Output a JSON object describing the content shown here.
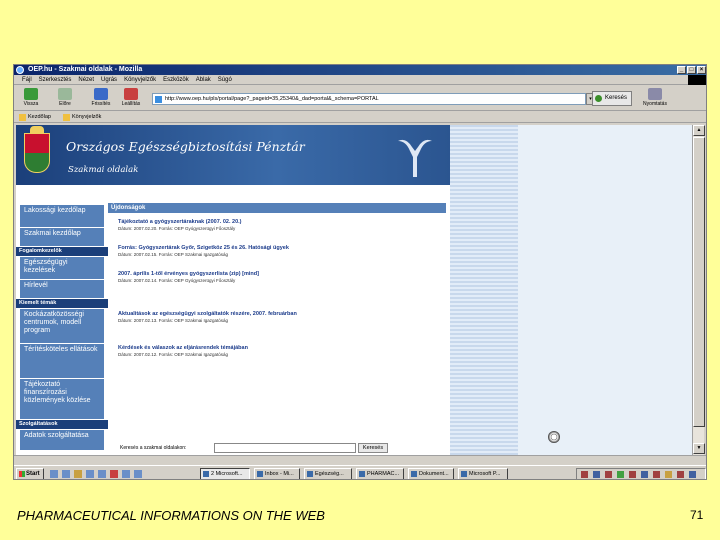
{
  "browser": {
    "title": "OEP.hu - Szakmai oldalak - Mozilla",
    "window_buttons": [
      "_",
      "□",
      "×"
    ],
    "menu": [
      "Fájl",
      "Szerkesztés",
      "Nézet",
      "Ugrás",
      "Könyvjelzők",
      "Eszközök",
      "Ablak",
      "Súgó"
    ],
    "brand": "",
    "toolbar": [
      "Vissza",
      "Előre",
      "Frissítés",
      "Leállítás"
    ],
    "address": "http://www.oep.hu/pls/portal/page?_pageid=35,25340&_dad=portal&_schema=PORTAL",
    "go_label": "Keresés",
    "print_label": "Nyomtatás",
    "links": [
      "Kezdőlap",
      "Könyvjelzők"
    ]
  },
  "site": {
    "org_name": "Országos Egészségbiztosítási Pénztár",
    "subtitle": "Szakmai oldalak",
    "left_nav": [
      {
        "type": "btn",
        "label": "Lakossági kezdőlap"
      },
      {
        "type": "btn",
        "label": "Szakmai kezdőlap"
      },
      {
        "type": "sec",
        "label": "Fogalomkezelők"
      },
      {
        "type": "btn",
        "label": "Egészségügyi kezelések"
      },
      {
        "type": "btn",
        "label": "Hírlevél"
      },
      {
        "type": "sec",
        "label": "Kiemelt témák"
      },
      {
        "type": "btn",
        "label": "Kockázatközösségi centrumok, modell program"
      },
      {
        "type": "btn",
        "label": "Térítésköteles ellátások"
      },
      {
        "type": "btn",
        "label": "Tájékoztató finanszírozási közlemények közlése"
      },
      {
        "type": "sec",
        "label": "Szolgáltatások"
      },
      {
        "type": "btn",
        "label": "Adatok szolgáltatása"
      }
    ],
    "news_header": "Újdonságok",
    "news": [
      {
        "title": "Tájékoztató a gyógyszertáraknak (2007. 02. 20.)",
        "desc": "Dátum: 2007.02.20. Forrás: OEP Gyógyszerügyi Főosztály"
      },
      {
        "title": "Forrás: Gyógyszertárak Győr, Szigetköz 25 és 26. Hatósági ügyek",
        "desc": "Dátum: 2007.02.15. Forrás: OEP Szakmai Igazgatóság"
      },
      {
        "title": "2007. április 1-től érvényes gyógyszerlista (zip) [mind]",
        "desc": "Dátum: 2007.02.14. Forrás: OEP Gyógyszerügyi Főosztály"
      },
      {
        "title": "Aktualitások az egészségügyi szolgáltatók részére, 2007. februárban",
        "desc": "Dátum: 2007.02.13. Forrás: OEP Szakmai Igazgatóság"
      },
      {
        "title": "Kérdések és válaszok az eljárásrendek témájában",
        "desc": "Dátum: 2007.02.12. Forrás: OEP Szakmai Igazgatóság"
      }
    ],
    "search_label": "Keresés a szakmai oldalakon:",
    "search_button": "Keresés"
  },
  "taskbar": {
    "start": "Start",
    "tasks": [
      "2 Microsoft...",
      "Inbox - Mi...",
      "Egészség...",
      "PHARMAC...",
      "Dokument...",
      "Microsoft P..."
    ]
  },
  "slide": {
    "footer": "PHARMACEUTICAL INFORMATIONS ON THE WEB",
    "page": "71"
  }
}
